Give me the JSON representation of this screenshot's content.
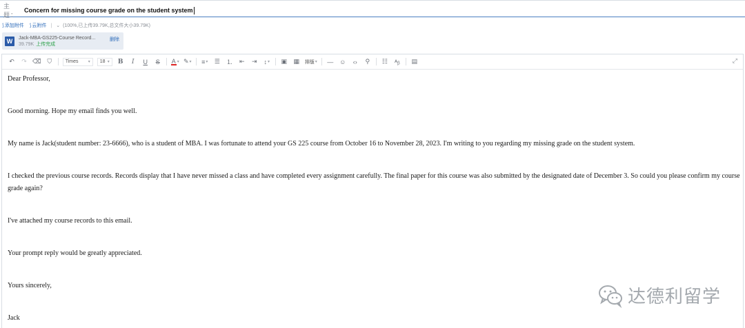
{
  "subject": {
    "label": "主 题：",
    "value": "Concern for missing course grade on the student system"
  },
  "attachments_bar": {
    "add_attachment": "添加附件",
    "cloud_attachment": "云附件",
    "status": "(100%,已上传39.79K,总文件大小39.79K)"
  },
  "attachment_file": {
    "icon": "word-icon",
    "icon_letter": "W",
    "name": "Jack-MBA-GS225-Course Record...",
    "size": "39.79K",
    "status": "上传完成",
    "delete_label": "删除"
  },
  "toolbar": {
    "font_family": "Times",
    "font_size": "18",
    "bold": "B",
    "italic": "I",
    "underline": "U",
    "strike": "S",
    "font_color": "A",
    "style_label": "排版",
    "items": [
      "undo-icon",
      "redo-icon",
      "eraser-icon",
      "format-painter-icon"
    ]
  },
  "email_body": {
    "p1": "Dear Professor,",
    "p2": "Good morning. Hope my email finds you well.",
    "p3": "My name is Jack(student number: 23-6666), who is a student of MBA. I was fortunate to attend your GS 225 course from October 16 to November 28, 2023. I'm writing to you regarding my missing grade on the student system.",
    "p4": "I checked the previous course records. Records display that I have never missed a class and have completed every assignment carefully. The final paper for this course was also submitted by the designated date of December 3. So could you please confirm my course grade again?",
    "p5": "I've attached my course records to this email.",
    "p6": "Your prompt reply would be greatly appreciated.",
    "p7": "Yours sincerely,",
    "p8": "Jack"
  },
  "watermark": {
    "text": "达德利留学",
    "icon": "wechat-icon"
  }
}
